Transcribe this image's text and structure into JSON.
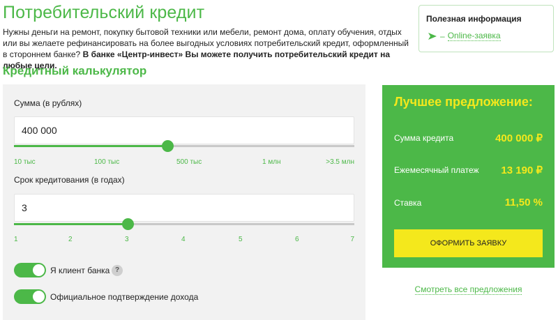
{
  "header": {
    "title": "Потребительский кредит",
    "intro_text": "Нужны деньги на ремонт, покупку бытовой техники или мебели, ремонт дома, оплату обучения, отдых или вы желаете рефинансировать на более выгодных условиях потребительский кредит, оформленный в стороннем банке? ",
    "intro_bold": "В банке «Центр-инвест» Вы можете получить потребительский кредит на любые цели."
  },
  "info_box": {
    "title": "Полезная информация",
    "dash": "–",
    "link_label": "Online-заявка"
  },
  "calculator": {
    "title": "Кредитный калькулятор",
    "amount": {
      "label": "Сумма (в рублях)",
      "value": "400 000",
      "slider_fraction": 0.45,
      "ticks": [
        "10 тыс",
        "100 тыс",
        "500 тыс",
        "1 млн",
        ">3.5 млн"
      ]
    },
    "term": {
      "label": "Срок кредитования (в годах)",
      "value": "3",
      "slider_fraction": 0.333,
      "ticks": [
        "1",
        "2",
        "3",
        "4",
        "5",
        "6",
        "7"
      ]
    },
    "toggles": {
      "client": {
        "label": "Я клиент банка",
        "on": true,
        "help": "?"
      },
      "income": {
        "label": "Официальное подтверждение дохода",
        "on": true
      }
    }
  },
  "offer": {
    "title": "Лучшее предложение:",
    "amount_label": "Сумма кредита",
    "amount_value": "400 000 ₽",
    "payment_label": "Ежемесячный платеж",
    "payment_value": "13 190 ₽",
    "rate_label": "Ставка",
    "rate_value": "11,50 %",
    "apply_label": "Оформить заявку",
    "all_offers_label": "Смотреть все предложения"
  },
  "colors": {
    "brand_green": "#4cb848",
    "accent_yellow": "#f4e81c"
  }
}
